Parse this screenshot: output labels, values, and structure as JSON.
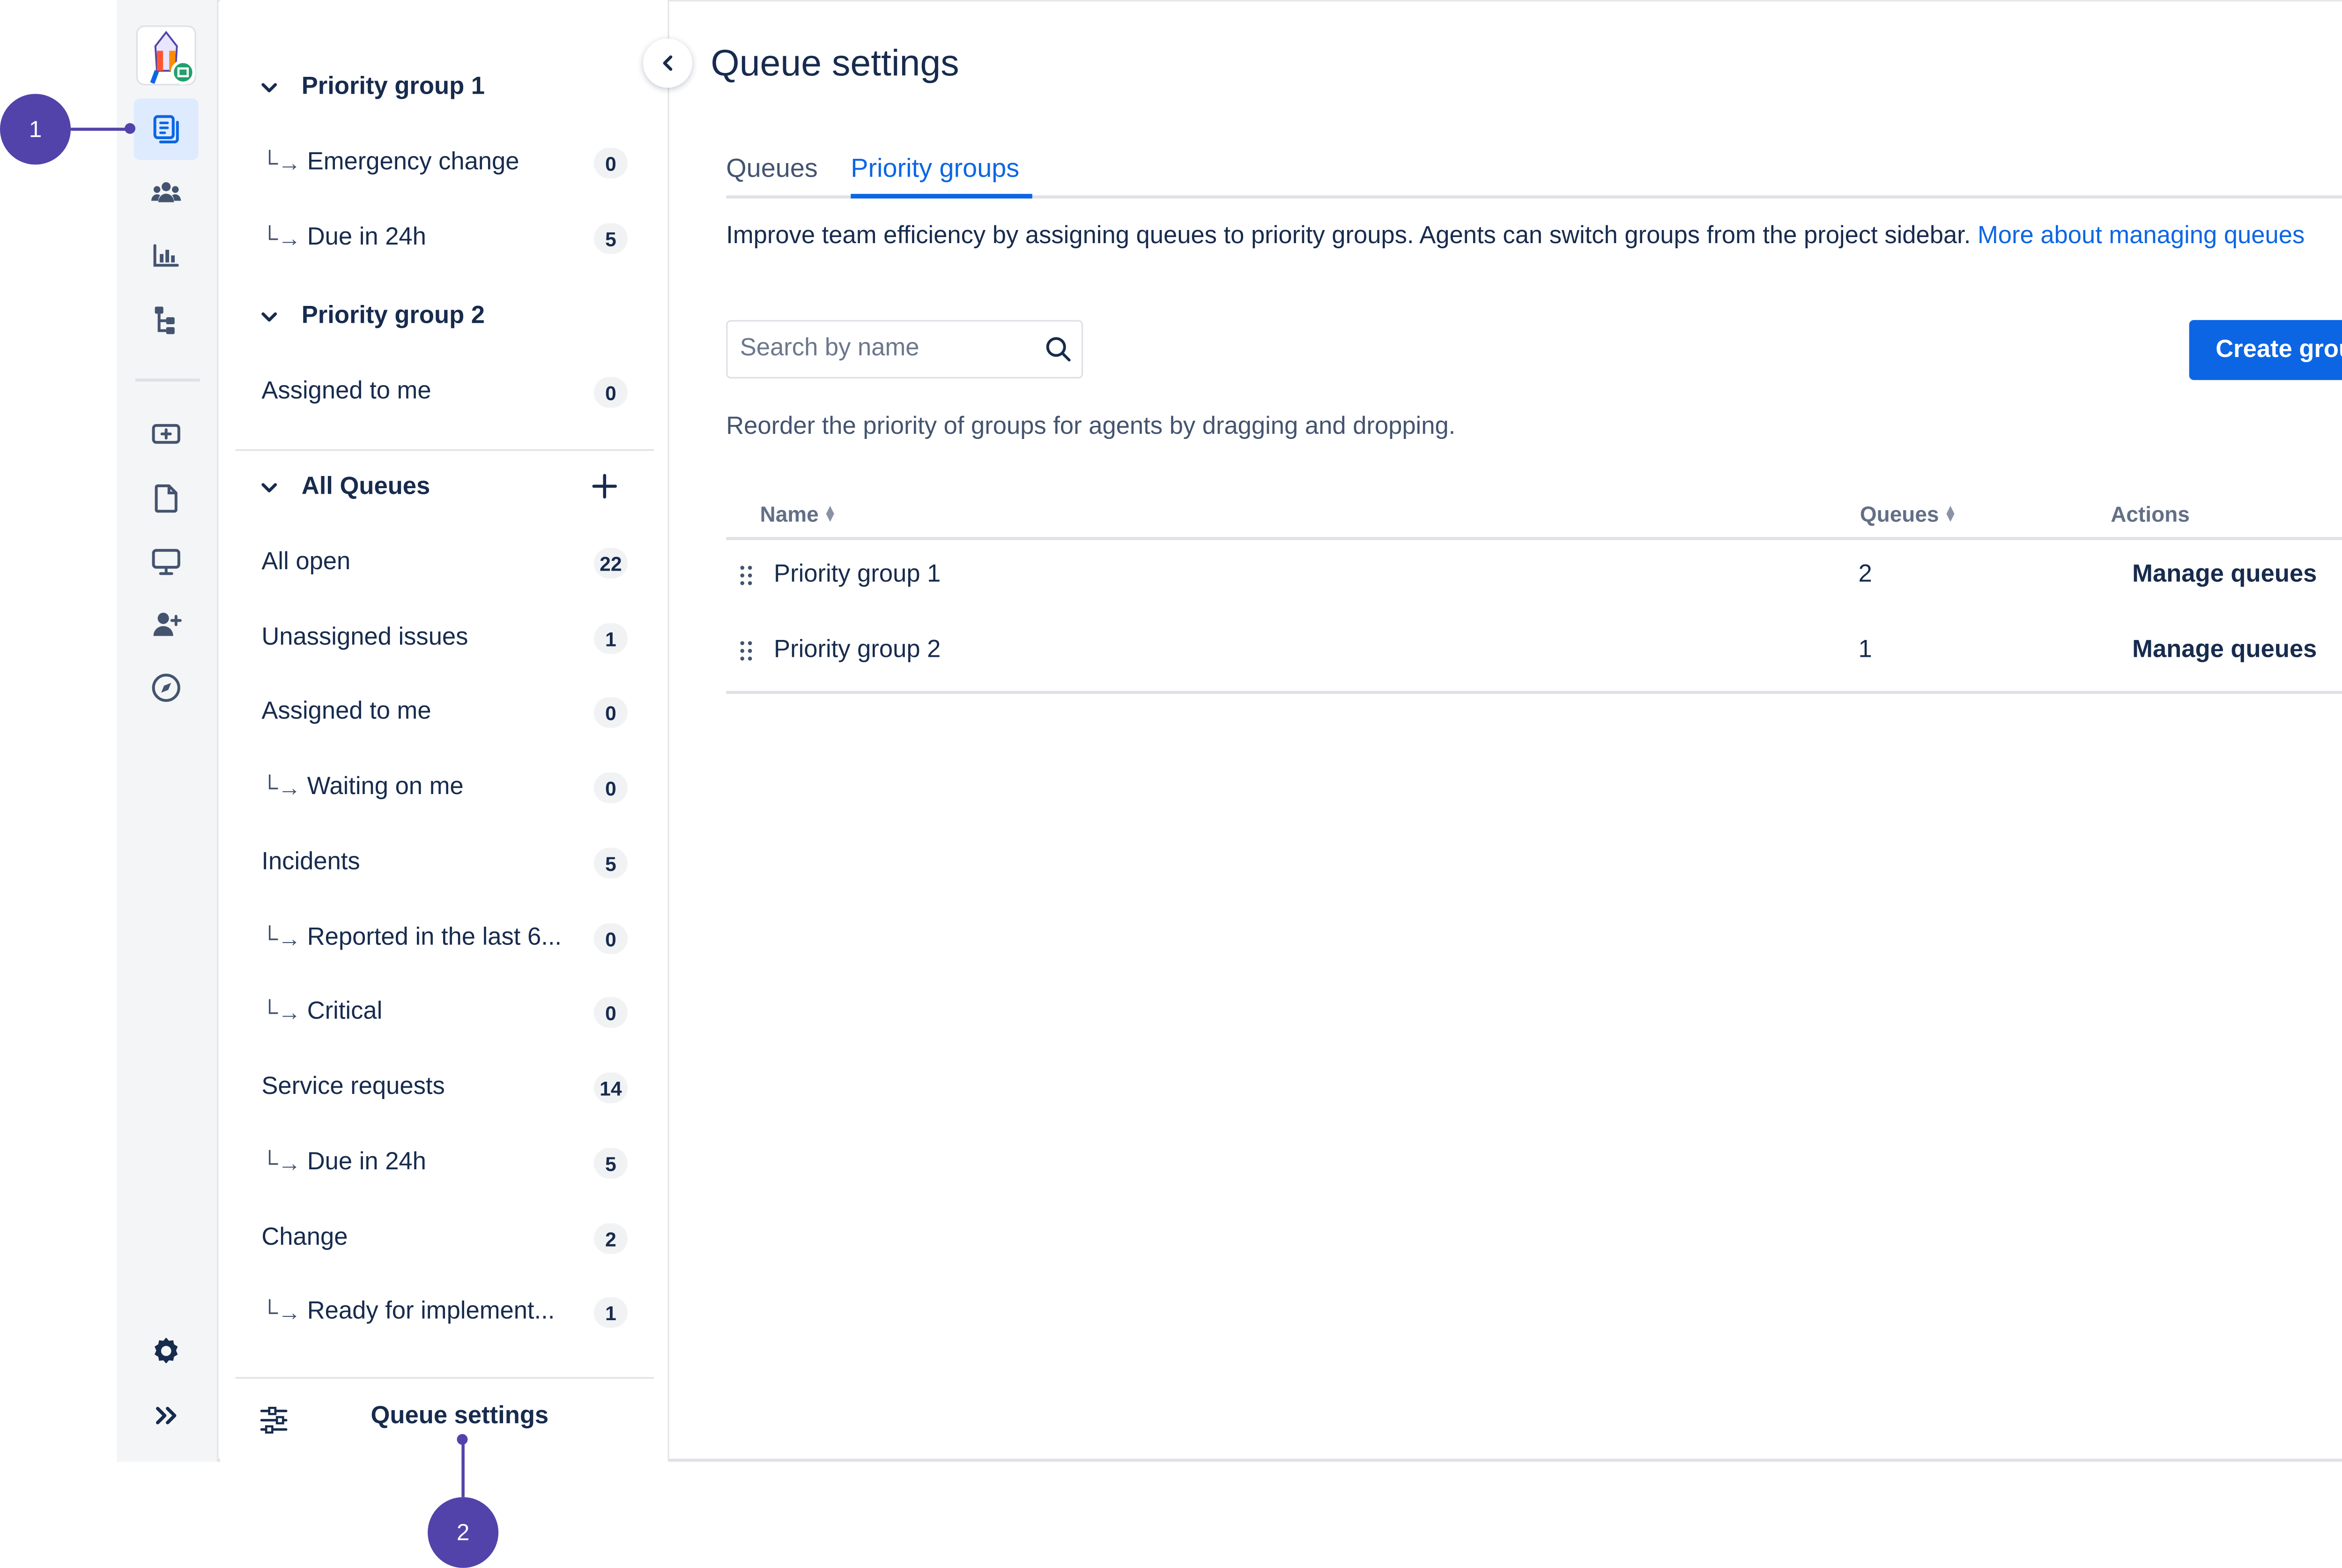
{
  "colors": {
    "accent": "#0C66E4",
    "callout": "#5243AA",
    "text": "#172B4D"
  },
  "rail": {
    "icons": [
      "project-avatar-icon",
      "queues-icon",
      "people-icon",
      "reports-icon",
      "hierarchy-icon",
      "raise-request-icon",
      "page-icon",
      "monitor-icon",
      "add-person-icon",
      "compass-icon",
      "settings-icon",
      "expand-icon"
    ]
  },
  "sidebar": {
    "groups": [
      {
        "label": "Priority group 1"
      },
      {
        "label": "Priority group 2"
      },
      {
        "label": "All Queues"
      }
    ],
    "items": [
      {
        "label": "Emergency change",
        "count": "0",
        "sub": true
      },
      {
        "label": "Due in 24h",
        "count": "5",
        "sub": true
      },
      {
        "label": "Assigned to me",
        "count": "0",
        "sub": false
      },
      {
        "label": "All open",
        "count": "22",
        "sub": false
      },
      {
        "label": "Unassigned issues",
        "count": "1",
        "sub": false
      },
      {
        "label": "Assigned to me",
        "count": "0",
        "sub": false
      },
      {
        "label": "Waiting on me",
        "count": "0",
        "sub": true
      },
      {
        "label": "Incidents",
        "count": "5",
        "sub": false
      },
      {
        "label": "Reported in the last 6...",
        "count": "0",
        "sub": true
      },
      {
        "label": "Critical",
        "count": "0",
        "sub": true
      },
      {
        "label": "Service requests",
        "count": "14",
        "sub": false
      },
      {
        "label": "Due in 24h",
        "count": "5",
        "sub": true
      },
      {
        "label": "Change",
        "count": "2",
        "sub": false
      },
      {
        "label": "Ready for implement...",
        "count": "1",
        "sub": true
      }
    ],
    "footer_label": "Queue settings"
  },
  "main": {
    "title": "Queue settings",
    "tabs": [
      {
        "label": "Queues"
      },
      {
        "label": "Priority groups"
      }
    ],
    "description": "Improve team efficiency by assigning queues to priority groups. Agents can switch groups from the project sidebar.",
    "link": "More about managing queues",
    "search_placeholder": "Search by name",
    "create_label": "Create group",
    "hint": "Reorder the priority of groups for agents by dragging and dropping.",
    "table": {
      "headers": [
        "Name",
        "Queues",
        "Actions"
      ],
      "rows": [
        {
          "name": "Priority group 1",
          "queues": "2",
          "action": "Manage queues",
          "more": "•••"
        },
        {
          "name": "Priority group 2",
          "queues": "1",
          "action": "Manage queues",
          "more": "•••"
        }
      ]
    }
  },
  "callouts": [
    "1",
    "2"
  ]
}
